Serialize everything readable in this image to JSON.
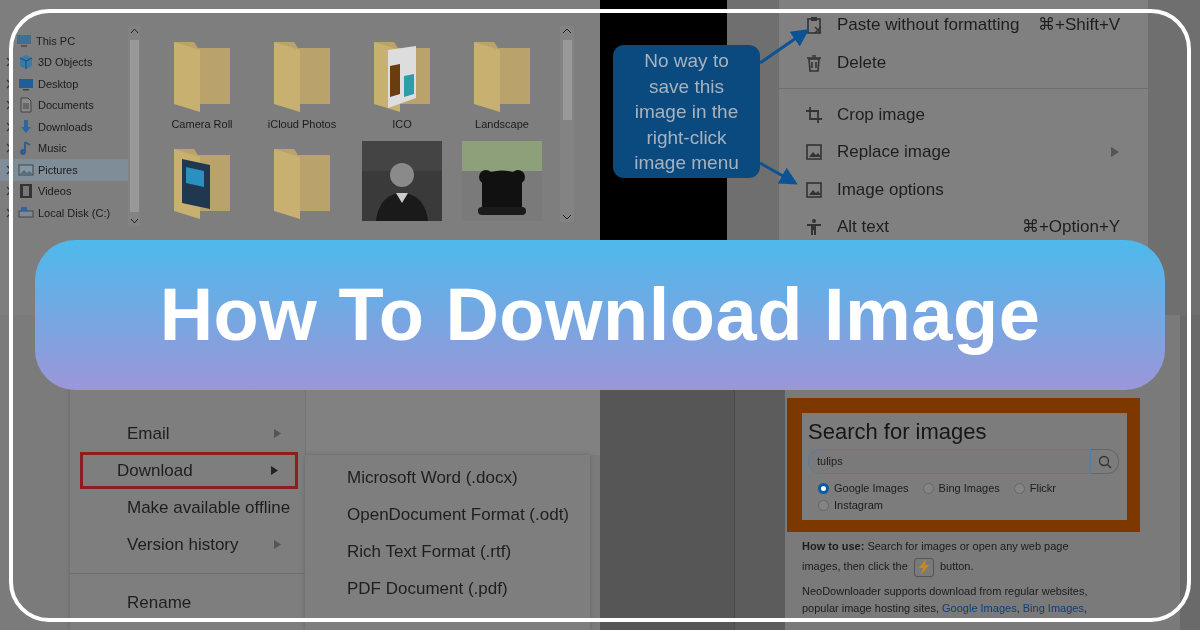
{
  "banner": {
    "title": "How To Download Image"
  },
  "file_explorer": {
    "tree": [
      {
        "label": "This PC",
        "selected": false,
        "children": [
          {
            "label": "3D Objects",
            "selected": false
          },
          {
            "label": "Desktop",
            "selected": false
          },
          {
            "label": "Documents",
            "selected": false
          },
          {
            "label": "Downloads",
            "selected": false
          },
          {
            "label": "Music",
            "selected": false
          },
          {
            "label": "Pictures",
            "selected": true
          },
          {
            "label": "Videos",
            "selected": false
          },
          {
            "label": "Local Disk (C:)",
            "selected": false
          }
        ]
      }
    ],
    "tiles": [
      {
        "label": "Camera Roll",
        "kind": "folder"
      },
      {
        "label": "iCloud Photos",
        "kind": "folder"
      },
      {
        "label": "ICO",
        "kind": "photo_folder"
      },
      {
        "label": "Landscape",
        "kind": "folder"
      },
      {
        "kind": "photo_folder"
      },
      {
        "kind": "folder"
      },
      {
        "kind": "picture"
      },
      {
        "kind": "picture"
      }
    ]
  },
  "image_menu": {
    "callout": "No way to save this image in the right-click image menu",
    "items": [
      {
        "kind": "item",
        "label": "Paste without formatting",
        "shortcut": "⌘+Shift+V",
        "submenu": false
      },
      {
        "kind": "item",
        "label": "Delete",
        "submenu": false
      },
      {
        "kind": "separator"
      },
      {
        "kind": "item",
        "label": "Crop image",
        "submenu": false
      },
      {
        "kind": "item",
        "label": "Replace image",
        "submenu": true
      },
      {
        "kind": "item",
        "label": "Image options",
        "submenu": false
      },
      {
        "kind": "item",
        "label": "Alt text",
        "shortcut": "⌘+Option+Y",
        "submenu": false
      }
    ]
  },
  "file_menu": {
    "items": [
      {
        "kind": "item",
        "label": "Email",
        "submenu": true,
        "highlighted": false
      },
      {
        "kind": "item",
        "label": "Download",
        "submenu": true,
        "highlighted": true
      },
      {
        "kind": "item",
        "label": "Make available offline",
        "submenu": false,
        "highlighted": false
      },
      {
        "kind": "item",
        "label": "Version history",
        "submenu": true,
        "highlighted": false
      },
      {
        "kind": "separator"
      },
      {
        "kind": "item",
        "label": "Rename",
        "submenu": false,
        "highlighted": false
      }
    ],
    "download_options": [
      "Microsoft Word (.docx)",
      "OpenDocument Format (.odt)",
      "Rich Text Format (.rtf)",
      "PDF Document (.pdf)"
    ]
  },
  "image_search": {
    "title": "Search for images",
    "query": "tulips",
    "sources": [
      {
        "label": "Google Images",
        "selected": true
      },
      {
        "label": "Bing Images",
        "selected": false
      },
      {
        "label": "Flickr",
        "selected": false
      },
      {
        "label": "Instagram",
        "selected": false
      }
    ],
    "how_to_use": "**How to use:** Search for images or open any web page",
    "click_before": "images, then click the",
    "click_after": "button.",
    "support_lines": [
      [
        {
          "kind": "text",
          "text": "NeoDownloader supports download from regular websites,"
        }
      ],
      [
        {
          "kind": "text",
          "text": "popular image hosting sites, "
        },
        {
          "kind": "link",
          "text": "Google Images"
        },
        {
          "kind": "text",
          "text": ", "
        },
        {
          "kind": "link",
          "text": "Bing Images"
        },
        {
          "kind": "text",
          "text": ","
        }
      ]
    ]
  }
}
